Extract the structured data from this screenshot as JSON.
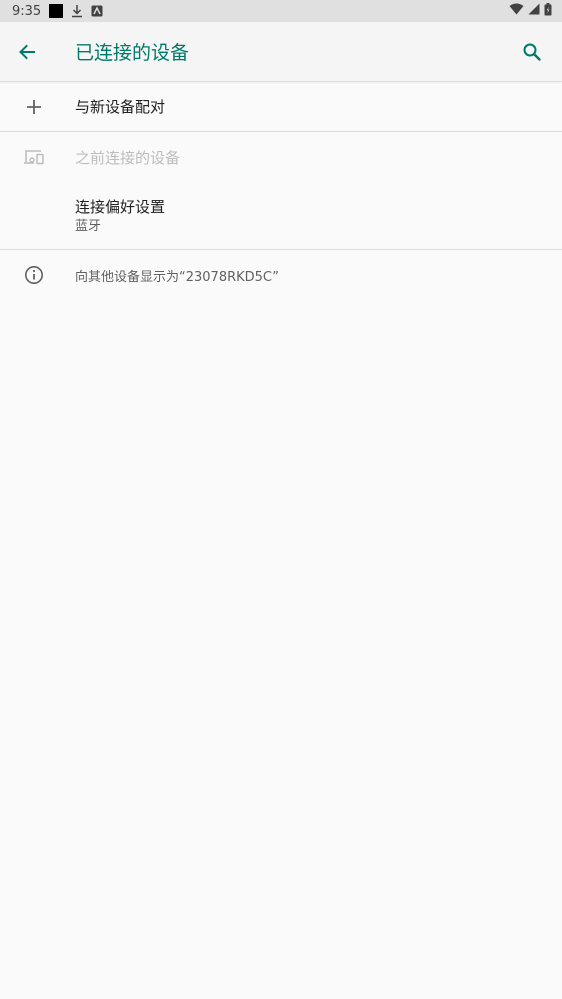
{
  "status_bar": {
    "time": "9:35"
  },
  "app_bar": {
    "title": "已连接的设备"
  },
  "pair_new_device": {
    "label": "与新设备配对"
  },
  "previous_devices": {
    "label": "之前连接的设备"
  },
  "connection_preferences": {
    "title": "连接偏好设置",
    "subtitle": "蓝牙"
  },
  "visibility_info": {
    "text": "向其他设备显示为“23078RKD5C”"
  },
  "colors": {
    "accent": "#00796b",
    "background": "#fafafa",
    "status_bar": "#e0e0e0",
    "disabled_text": "#bdbdbd"
  },
  "icons": {
    "back": "arrow-left-icon",
    "search": "search-icon",
    "pair": "plus-icon",
    "previous": "devices-icon",
    "info": "info-icon",
    "wifi": "wifi-icon",
    "signal": "signal-icon",
    "battery": "battery-icon",
    "download": "download-icon",
    "notification": "notification-icon"
  }
}
